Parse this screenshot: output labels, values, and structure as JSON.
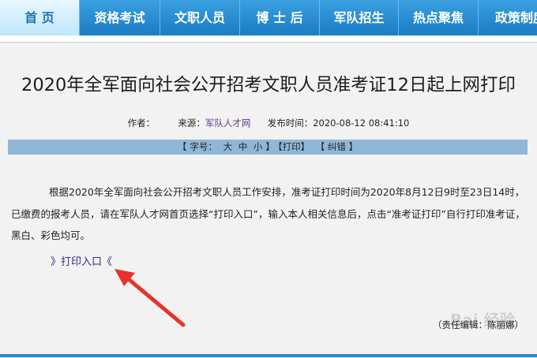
{
  "nav": {
    "items": [
      {
        "label": "首  页",
        "active": true
      },
      {
        "label": "资格考试",
        "active": false
      },
      {
        "label": "文职人员",
        "active": false
      },
      {
        "label": "博 士 后",
        "active": false
      },
      {
        "label": "军队招生",
        "active": false
      },
      {
        "label": "热点聚焦",
        "active": false
      },
      {
        "label": "政策制度",
        "active": false
      }
    ]
  },
  "article": {
    "title": "2020年全军面向社会公开招考文职人员准考证12日起上网打印",
    "author_label": "作者：",
    "source_label": "来源：",
    "source_value": "军队人才网",
    "published_label": "发布时间：",
    "published_value": "2020-08-12 08:41:10",
    "body": "根据2020年全军面向社会公开招考文职人员工作安排，准考证打印时间为2020年8月12日9时至23日14时，已缴费的报考人员，请在军队人才网首页选择“打印入口”，输入本人相关信息后，点击“准考证打印”自行打印准考证，黑白、彩色均可。",
    "entry_link": "》打印入口《",
    "editor": "（责任编辑：陈丽娜）"
  },
  "toolbar": {
    "open1": "【",
    "font_label": "字号：",
    "size_large": "大",
    "size_medium": "中",
    "size_small": "小",
    "close1": "】",
    "print": "【打印】",
    "correct": "【 纠错 】"
  },
  "watermark": "Bai 经验",
  "colors": {
    "nav_bg": "#1a7cc4",
    "toolbar_bg": "#8fb7d8",
    "arrow": "#e8322a"
  }
}
